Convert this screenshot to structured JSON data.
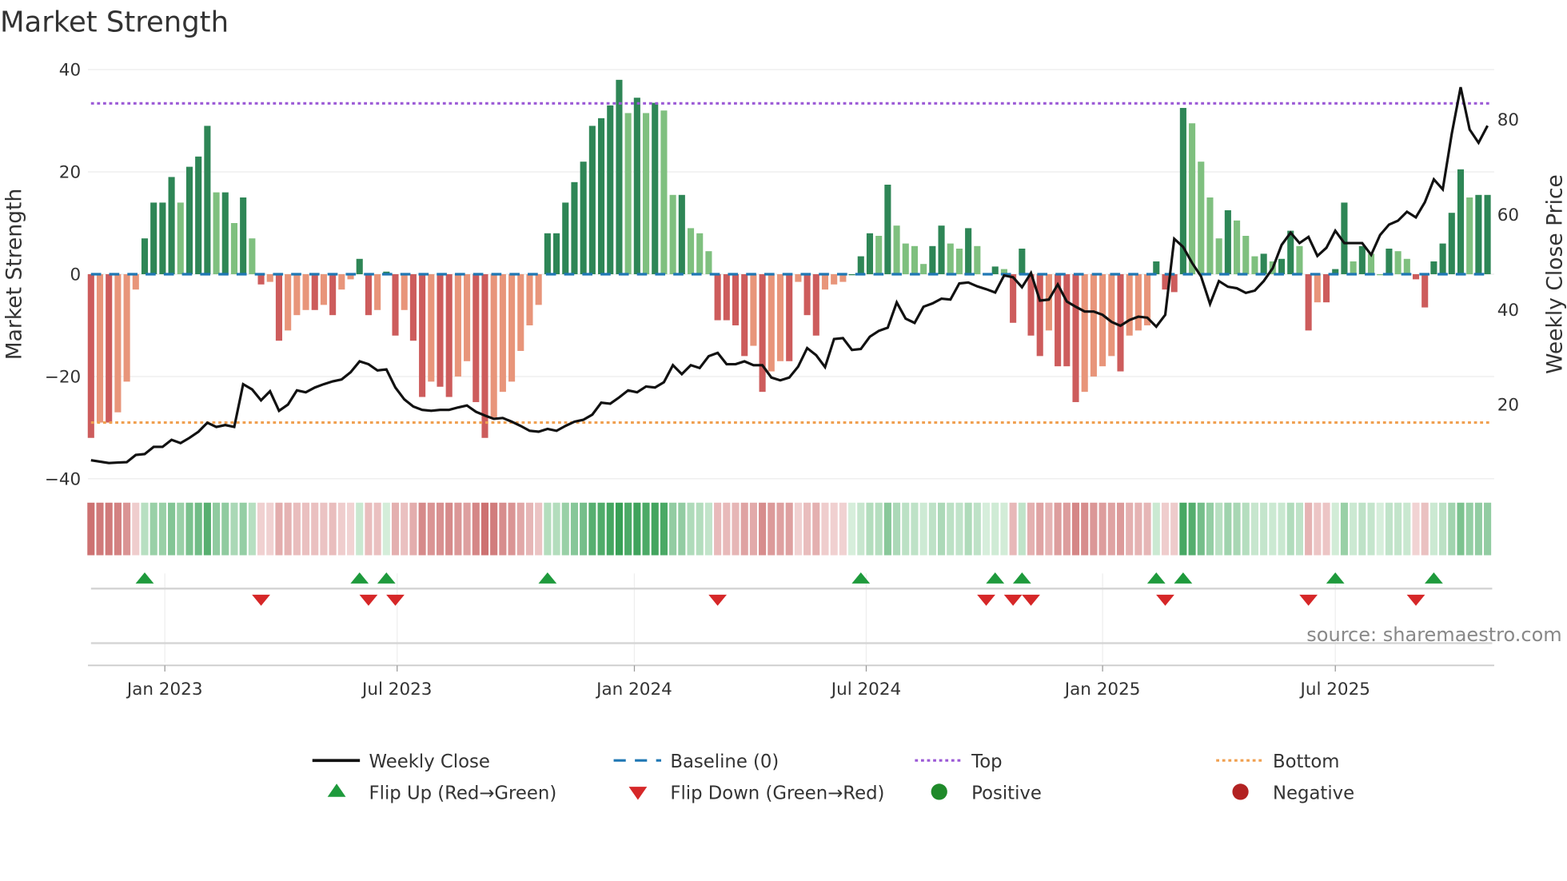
{
  "chart_data": {
    "type": "bar",
    "title": "Market Strength",
    "ylabel": "Market Strength",
    "y2label": "Weekly Close Price",
    "ylim": [
      -40,
      40
    ],
    "y2lim": [
      0,
      90
    ],
    "yticks": [
      "40",
      "20",
      "0",
      "−20",
      "−40"
    ],
    "ytick_values": [
      40,
      20,
      0,
      -20,
      -40
    ],
    "y2ticks": [
      "80",
      "60",
      "40",
      "20"
    ],
    "y2tick_values": [
      80,
      60,
      40,
      20
    ],
    "x_unit": "weeks (approx. Nov 2022 – Nov 2025)",
    "xticks": [
      {
        "label": "Jan 2023",
        "week": 8.25
      },
      {
        "label": "Jul 2023",
        "week": 34.2
      },
      {
        "label": "Jan 2024",
        "week": 60.7
      },
      {
        "label": "Jul 2024",
        "week": 86.6
      },
      {
        "label": "Jan 2025",
        "week": 113.0
      },
      {
        "label": "Jul 2025",
        "week": 139.0
      }
    ],
    "top_level": 33.4,
    "bottom_level": -29,
    "baseline": 0,
    "strength": [
      -32,
      -29,
      -29,
      -27,
      -21,
      -3,
      7,
      14,
      14,
      19,
      14,
      21,
      23,
      29,
      16,
      16,
      10,
      15,
      7,
      -2,
      -1.5,
      -13,
      -11,
      -8,
      -7,
      -7,
      -6,
      -8,
      -3,
      -1,
      3,
      -8,
      -7,
      0.5,
      -12,
      -7,
      -13,
      -24,
      -21,
      -22,
      -24,
      -20,
      -17,
      -25,
      -32,
      -28,
      -23,
      -21,
      -15,
      -10,
      -6,
      8,
      8,
      14,
      18,
      22,
      29,
      30.5,
      33,
      38,
      31.5,
      34.5,
      31.5,
      33.5,
      32,
      15.5,
      15.5,
      9,
      8,
      4.5,
      -9,
      -9,
      -10,
      -16,
      -14,
      -23,
      -19,
      -17,
      -17,
      -1.5,
      -8,
      -12,
      -3,
      -2,
      -1.5,
      0,
      3.5,
      8,
      7.5,
      17.5,
      9.5,
      6,
      5.5,
      2,
      5.5,
      9.5,
      6,
      5,
      9,
      5.5,
      0,
      1.5,
      1,
      -9.5,
      5,
      -12,
      -16,
      -11,
      -18,
      -18,
      -25,
      -23,
      -20,
      -18,
      -16,
      -19,
      -12,
      -11,
      -10,
      2.5,
      -3,
      -3.5,
      32.5,
      29.5,
      22,
      15,
      7,
      12.5,
      10.5,
      7.5,
      3.5,
      4,
      2.5,
      3,
      8.5,
      5.5,
      -11,
      -5.5,
      -5.5,
      1,
      14,
      2.5,
      5.5,
      4,
      0,
      5,
      4.5,
      3,
      -1,
      -6.5,
      2.5,
      6,
      12,
      20.5,
      15,
      15.5,
      15.5
    ],
    "weekly_close": [
      8.3,
      8.0,
      7.7,
      7.8,
      7.9,
      9.4,
      9.6,
      11.1,
      11.1,
      12.6,
      11.9,
      13,
      14.3,
      16.2,
      15.3,
      15.7,
      15.3,
      24.3,
      23.2,
      20.9,
      22.8,
      18.7,
      20,
      23,
      22.6,
      23.6,
      24.3,
      24.9,
      25.3,
      26.8,
      29.1,
      28.5,
      27.2,
      27.4,
      23.6,
      21.1,
      19.6,
      18.9,
      18.7,
      18.9,
      18.9,
      19.4,
      19.8,
      18.5,
      17.7,
      17,
      17.2,
      16.4,
      15.5,
      14.5,
      14.3,
      14.9,
      14.5,
      15.5,
      16.4,
      16.8,
      17.9,
      20.4,
      20.2,
      21.5,
      23,
      22.6,
      23.8,
      23.6,
      24.7,
      28.3,
      26.4,
      28.3,
      27.7,
      30.2,
      30.9,
      28.5,
      28.5,
      29.1,
      28.3,
      28.3,
      25.7,
      25.1,
      25.7,
      28,
      31.9,
      30.4,
      27.9,
      33.8,
      34,
      31.5,
      31.7,
      34.3,
      35.5,
      36.2,
      41.5,
      38.1,
      37.2,
      40.6,
      41.3,
      42.3,
      42.1,
      45.5,
      45.7,
      44.9,
      44.3,
      43.6,
      47.2,
      46.8,
      44.7,
      47.7,
      41.9,
      42.1,
      45.3,
      41.7,
      40.6,
      39.6,
      39.6,
      38.9,
      37.4,
      36.6,
      37.8,
      38.5,
      38.3,
      36.4,
      38.9,
      54.9,
      53.2,
      49.8,
      47,
      41.2,
      46,
      44.8,
      44.5,
      43.5,
      44,
      46,
      48.7,
      53.6,
      56.2,
      54,
      55.3,
      51.3,
      53,
      56.6,
      54,
      54,
      54,
      51.5,
      55.7,
      57.9,
      58.7,
      60.6,
      59.4,
      62.6,
      67.4,
      65.3,
      77,
      86.8,
      77.9,
      75.1,
      78.7
    ],
    "flip_up_weeks": [
      6,
      30,
      33,
      51,
      86,
      101,
      104,
      119,
      122,
      139,
      150
    ],
    "flip_down_weeks": [
      19,
      31,
      34,
      70,
      100,
      103,
      105,
      120,
      136,
      148
    ],
    "legend_placement": "bottom",
    "legend": [
      {
        "label": "Weekly Close"
      },
      {
        "label": "Baseline (0)"
      },
      {
        "label": "Top"
      },
      {
        "label": "Bottom"
      },
      {
        "label": "Flip Up (Red→Green)"
      },
      {
        "label": "Flip Down (Green→Red)"
      },
      {
        "label": "Positive"
      },
      {
        "label": "Negative"
      }
    ],
    "source": "source: sharemaestro.com",
    "colors": {
      "pos_strong": "#2e8656",
      "pos_weak": "#7fc07f",
      "neg_strong": "#cd5c5c",
      "neg_weak": "#e8957a",
      "close": "#111111",
      "baseline": "#1f77b4",
      "top": "#9b59d6",
      "bottom": "#f0a050",
      "flip_up": "#1e9a3c",
      "flip_down": "#d62728",
      "positive": "#1f8a2a",
      "negative": "#b22222"
    }
  }
}
